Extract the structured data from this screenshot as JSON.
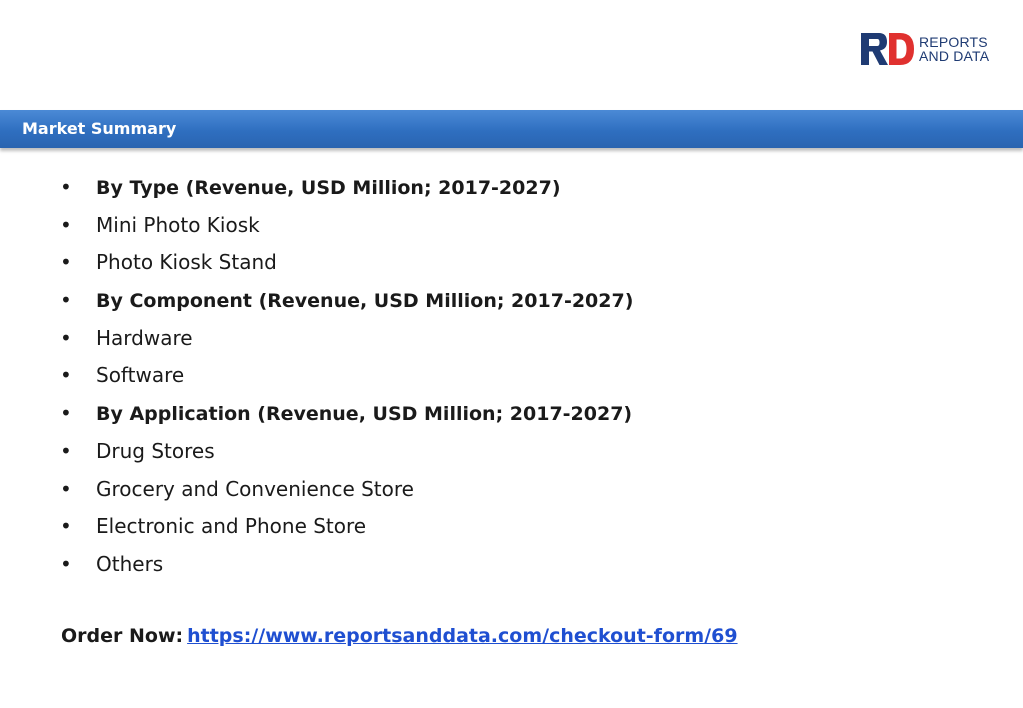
{
  "logo": {
    "line1": "REPORTS",
    "line2": "AND DATA",
    "colors": {
      "navy": "#1f3b73",
      "red": "#e0312f"
    }
  },
  "header": {
    "title": "Market Summary",
    "bar_color": "#2f6fc0"
  },
  "items": [
    {
      "text": "By Type (Revenue, USD Million; 2017-2027)",
      "bold": true
    },
    {
      "text": "Mini Photo Kiosk",
      "bold": false
    },
    {
      "text": "Photo Kiosk Stand",
      "bold": false
    },
    {
      "text": "By Component (Revenue, USD Million; 2017-2027)",
      "bold": true
    },
    {
      "text": "Hardware",
      "bold": false
    },
    {
      "text": "Software",
      "bold": false
    },
    {
      "text": "By Application (Revenue, USD Million; 2017-2027)",
      "bold": true
    },
    {
      "text": "Drug Stores",
      "bold": false
    },
    {
      "text": "Grocery and Convenience Store",
      "bold": false
    },
    {
      "text": "Electronic and Phone Store",
      "bold": false
    },
    {
      "text": "Others",
      "bold": false
    }
  ],
  "bullet_char": "•",
  "order": {
    "label": "Order Now:",
    "link_text": "https://www.reportsanddata.com/checkout-form/69"
  }
}
